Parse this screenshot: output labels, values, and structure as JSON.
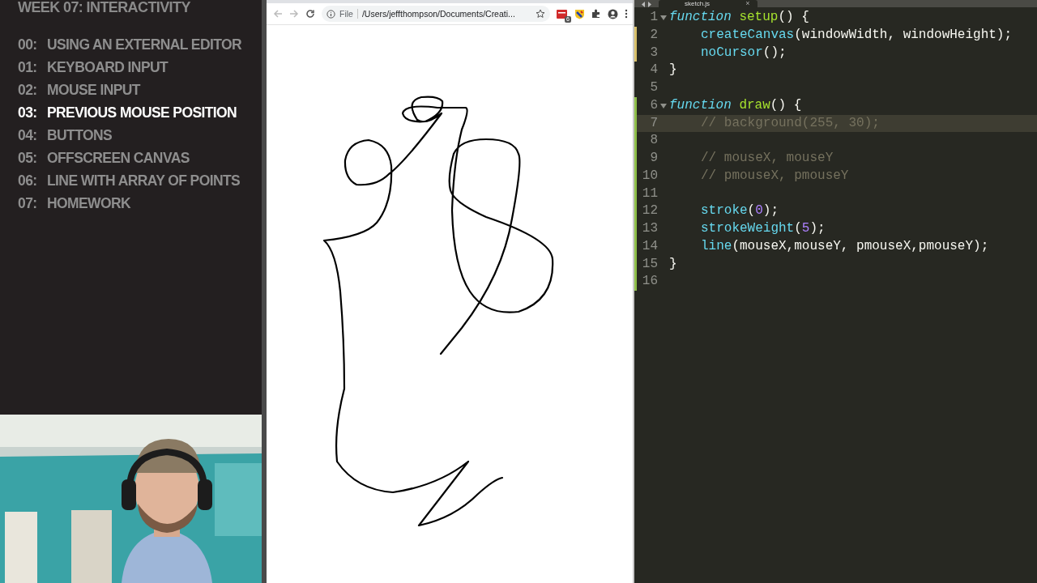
{
  "sidebar": {
    "title": "WEEK 07: INTERACTIVITY",
    "items": [
      {
        "number": "00:",
        "label": "USING AN EXTERNAL EDITOR",
        "selected": false
      },
      {
        "number": "01:",
        "label": "KEYBOARD INPUT",
        "selected": false
      },
      {
        "number": "02:",
        "label": "MOUSE INPUT",
        "selected": false
      },
      {
        "number": "03:",
        "label": "PREVIOUS MOUSE POSITION",
        "selected": true
      },
      {
        "number": "04:",
        "label": "BUTTONS",
        "selected": false
      },
      {
        "number": "05:",
        "label": "OFFSCREEN CANVAS",
        "selected": false
      },
      {
        "number": "06:",
        "label": "LINE WITH ARRAY OF POINTS",
        "selected": false
      },
      {
        "number": "07:",
        "label": "HOMEWORK",
        "selected": false
      }
    ]
  },
  "browser": {
    "scheme": "File",
    "url": "/Users/jeffthompson/Documents/Creati...",
    "extension_badge": "6"
  },
  "editor": {
    "tab": {
      "label": "sketch.js",
      "close": "×"
    },
    "lines": [
      {
        "number": "1",
        "fold": true,
        "modified": false,
        "added": false,
        "current": false,
        "indented": false,
        "tokens": [
          {
            "kind": "storage",
            "text": "function"
          },
          {
            "kind": "entity",
            "text": " setup"
          },
          {
            "kind": "plain",
            "text": "() {"
          }
        ]
      },
      {
        "number": "2",
        "fold": false,
        "modified": true,
        "added": false,
        "current": false,
        "indented": true,
        "tokens": [
          {
            "kind": "support",
            "text": "createCanvas"
          },
          {
            "kind": "plain",
            "text": "(windowWidth, windowHeight);"
          }
        ]
      },
      {
        "number": "3",
        "fold": false,
        "modified": true,
        "added": false,
        "current": false,
        "indented": true,
        "tokens": [
          {
            "kind": "support",
            "text": "noCursor"
          },
          {
            "kind": "plain",
            "text": "();"
          }
        ]
      },
      {
        "number": "4",
        "fold": false,
        "modified": false,
        "added": false,
        "current": false,
        "indented": false,
        "tokens": [
          {
            "kind": "plain",
            "text": "}"
          }
        ]
      },
      {
        "number": "5",
        "fold": false,
        "modified": false,
        "added": false,
        "current": false
      },
      {
        "number": "6",
        "fold": true,
        "modified": false,
        "added": true,
        "current": false,
        "indented": false,
        "tokens": [
          {
            "kind": "storage",
            "text": "function"
          },
          {
            "kind": "entity",
            "text": " draw"
          },
          {
            "kind": "plain",
            "text": "() {"
          }
        ]
      },
      {
        "number": "7",
        "fold": false,
        "modified": false,
        "added": true,
        "current": true,
        "indented": true,
        "tokens": [
          {
            "kind": "comment",
            "text": "// background(255, 30);"
          }
        ]
      },
      {
        "number": "8",
        "fold": false,
        "modified": false,
        "added": true,
        "current": false
      },
      {
        "number": "9",
        "fold": false,
        "modified": false,
        "added": true,
        "current": false,
        "indented": true,
        "tokens": [
          {
            "kind": "comment",
            "text": "// mouseX, mouseY"
          }
        ]
      },
      {
        "number": "10",
        "fold": false,
        "modified": false,
        "added": true,
        "current": false,
        "indented": true,
        "tokens": [
          {
            "kind": "comment",
            "text": "// pmouseX, pmouseY"
          }
        ]
      },
      {
        "number": "11",
        "fold": false,
        "modified": false,
        "added": true,
        "current": false
      },
      {
        "number": "12",
        "fold": false,
        "modified": false,
        "added": true,
        "current": false,
        "indented": true,
        "tokens": [
          {
            "kind": "support",
            "text": "stroke"
          },
          {
            "kind": "plain",
            "text": "("
          },
          {
            "kind": "number",
            "text": "0"
          },
          {
            "kind": "plain",
            "text": ");"
          }
        ]
      },
      {
        "number": "13",
        "fold": false,
        "modified": false,
        "added": true,
        "current": false,
        "indented": true,
        "tokens": [
          {
            "kind": "support",
            "text": "strokeWeight"
          },
          {
            "kind": "plain",
            "text": "("
          },
          {
            "kind": "number",
            "text": "5"
          },
          {
            "kind": "plain",
            "text": ");"
          }
        ]
      },
      {
        "number": "14",
        "fold": false,
        "modified": false,
        "added": true,
        "current": false,
        "indented": true,
        "tokens": [
          {
            "kind": "support",
            "text": "line"
          },
          {
            "kind": "plain",
            "text": "(mouseX,mouseY, pmouseX,pmouseY);"
          }
        ]
      },
      {
        "number": "15",
        "fold": false,
        "modified": false,
        "added": true,
        "current": false,
        "indented": false,
        "tokens": [
          {
            "kind": "plain",
            "text": "}"
          }
        ]
      },
      {
        "number": "16",
        "fold": false,
        "modified": false,
        "added": true,
        "current": false
      }
    ]
  }
}
